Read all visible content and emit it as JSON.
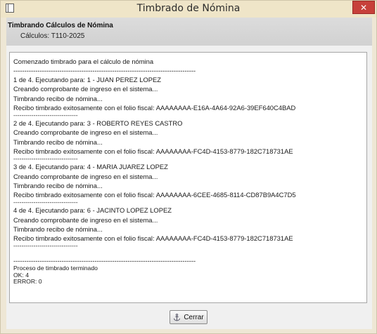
{
  "window": {
    "title": "Timbrado de Nómina",
    "close_glyph": "✕",
    "app_icon": "window-icon",
    "close_color": "#c7403a"
  },
  "header": {
    "title": "Timbrando Cálculos de Nómina",
    "subtitle": "Cálculos: T110-2025"
  },
  "log": {
    "lines": [
      {
        "text": "Comenzado timbrado para el cálculo de nómina",
        "size": "n"
      },
      {
        "text": "-----------------------------------------------------------------------------------",
        "size": "n"
      },
      {
        "text": "1 de 4. Ejecutando para: 1 - JUAN PEREZ LOPEZ",
        "size": "n"
      },
      {
        "text": "Creando comprobante de ingreso en el sistema...",
        "size": "n"
      },
      {
        "text": "Timbrando recibo de nómina...",
        "size": "n"
      },
      {
        "text": "Recibo timbrado exitosamente con el folio fiscal: AAAAAAAA-E16A-4A64-92A6-39EF640C4BAD",
        "size": "n"
      },
      {
        "text": "--------------------------------",
        "size": "sm"
      },
      {
        "text": "2 de 4. Ejecutando para: 3 - ROBERTO REYES CASTRO",
        "size": "n"
      },
      {
        "text": "Creando comprobante de ingreso en el sistema...",
        "size": "n"
      },
      {
        "text": "Timbrando recibo de nómina...",
        "size": "n"
      },
      {
        "text": "Recibo timbrado exitosamente con el folio fiscal: AAAAAAAA-FC4D-4153-8779-182C718731AE",
        "size": "n"
      },
      {
        "text": "--------------------------------",
        "size": "sm"
      },
      {
        "text": "3 de 4. Ejecutando para: 4 - MARIA JUAREZ LOPEZ",
        "size": "n"
      },
      {
        "text": "Creando comprobante de ingreso en el sistema...",
        "size": "n"
      },
      {
        "text": "Timbrando recibo de nómina...",
        "size": "n"
      },
      {
        "text": "Recibo timbrado exitosamente con el folio fiscal: AAAAAAAA-6CEE-4685-8114-CD87B9A4C7D5",
        "size": "n"
      },
      {
        "text": "--------------------------------",
        "size": "sm"
      },
      {
        "text": "4 de 4. Ejecutando para: 6 - JACINTO LOPEZ LOPEZ",
        "size": "n"
      },
      {
        "text": "Creando comprobante de ingreso en el sistema...",
        "size": "n"
      },
      {
        "text": "Timbrando recibo de nómina...",
        "size": "n"
      },
      {
        "text": "Recibo timbrado exitosamente con el folio fiscal: AAAAAAAA-FC4D-4153-8779-182C718731AE",
        "size": "n"
      },
      {
        "text": "--------------------------------",
        "size": "sm"
      },
      {
        "text": "",
        "size": "sm"
      },
      {
        "text": "-----------------------------------------------------------------------------------",
        "size": "n"
      },
      {
        "text": "Proceso de timbrado terminado",
        "size": "sm"
      },
      {
        "text": "OK: 4",
        "size": "sm"
      },
      {
        "text": "ERROR: 0",
        "size": "sm"
      }
    ]
  },
  "footer": {
    "close_label": "Cerrar",
    "close_icon": "anchor-icon"
  }
}
